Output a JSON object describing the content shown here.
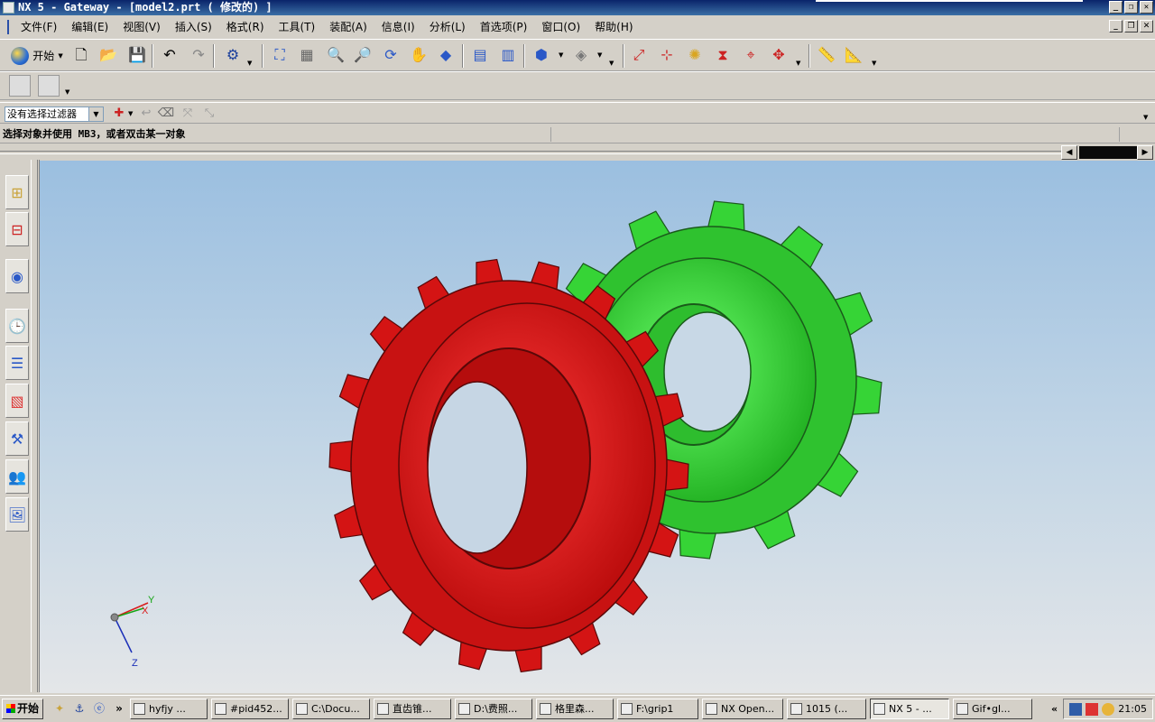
{
  "window": {
    "title": "NX 5 - Gateway - [model2.prt ( 修改的) ]"
  },
  "menu": [
    "文件(F)",
    "编辑(E)",
    "视图(V)",
    "插入(S)",
    "格式(R)",
    "工具(T)",
    "装配(A)",
    "信息(I)",
    "分析(L)",
    "首选项(P)",
    "窗口(O)",
    "帮助(H)"
  ],
  "toolbar": {
    "start_label": "开始",
    "filter_value": "没有选择过滤器"
  },
  "cue_line": {
    "message": "选择对象并使用 MB3，或者双击某一对象"
  },
  "triad": {
    "x_label": "X",
    "y_label": "Y",
    "z_label": "Z"
  },
  "colors": {
    "gear_red": "#e01414",
    "gear_green": "#3be03b",
    "title_blue": "#0a246a"
  },
  "taskbar": {
    "start_label": "开始",
    "chevron": "»",
    "tasks": [
      "hyfjy ...",
      "#pid452...",
      "C:\\Docu...",
      "直齿锥...",
      "D:\\费照...",
      "格里森...",
      "F:\\grip1",
      "NX Open...",
      "1015 (...",
      "NX 5 - ...",
      "Gif•gI..."
    ],
    "tray_arrow": "«",
    "clock": "21:05"
  }
}
